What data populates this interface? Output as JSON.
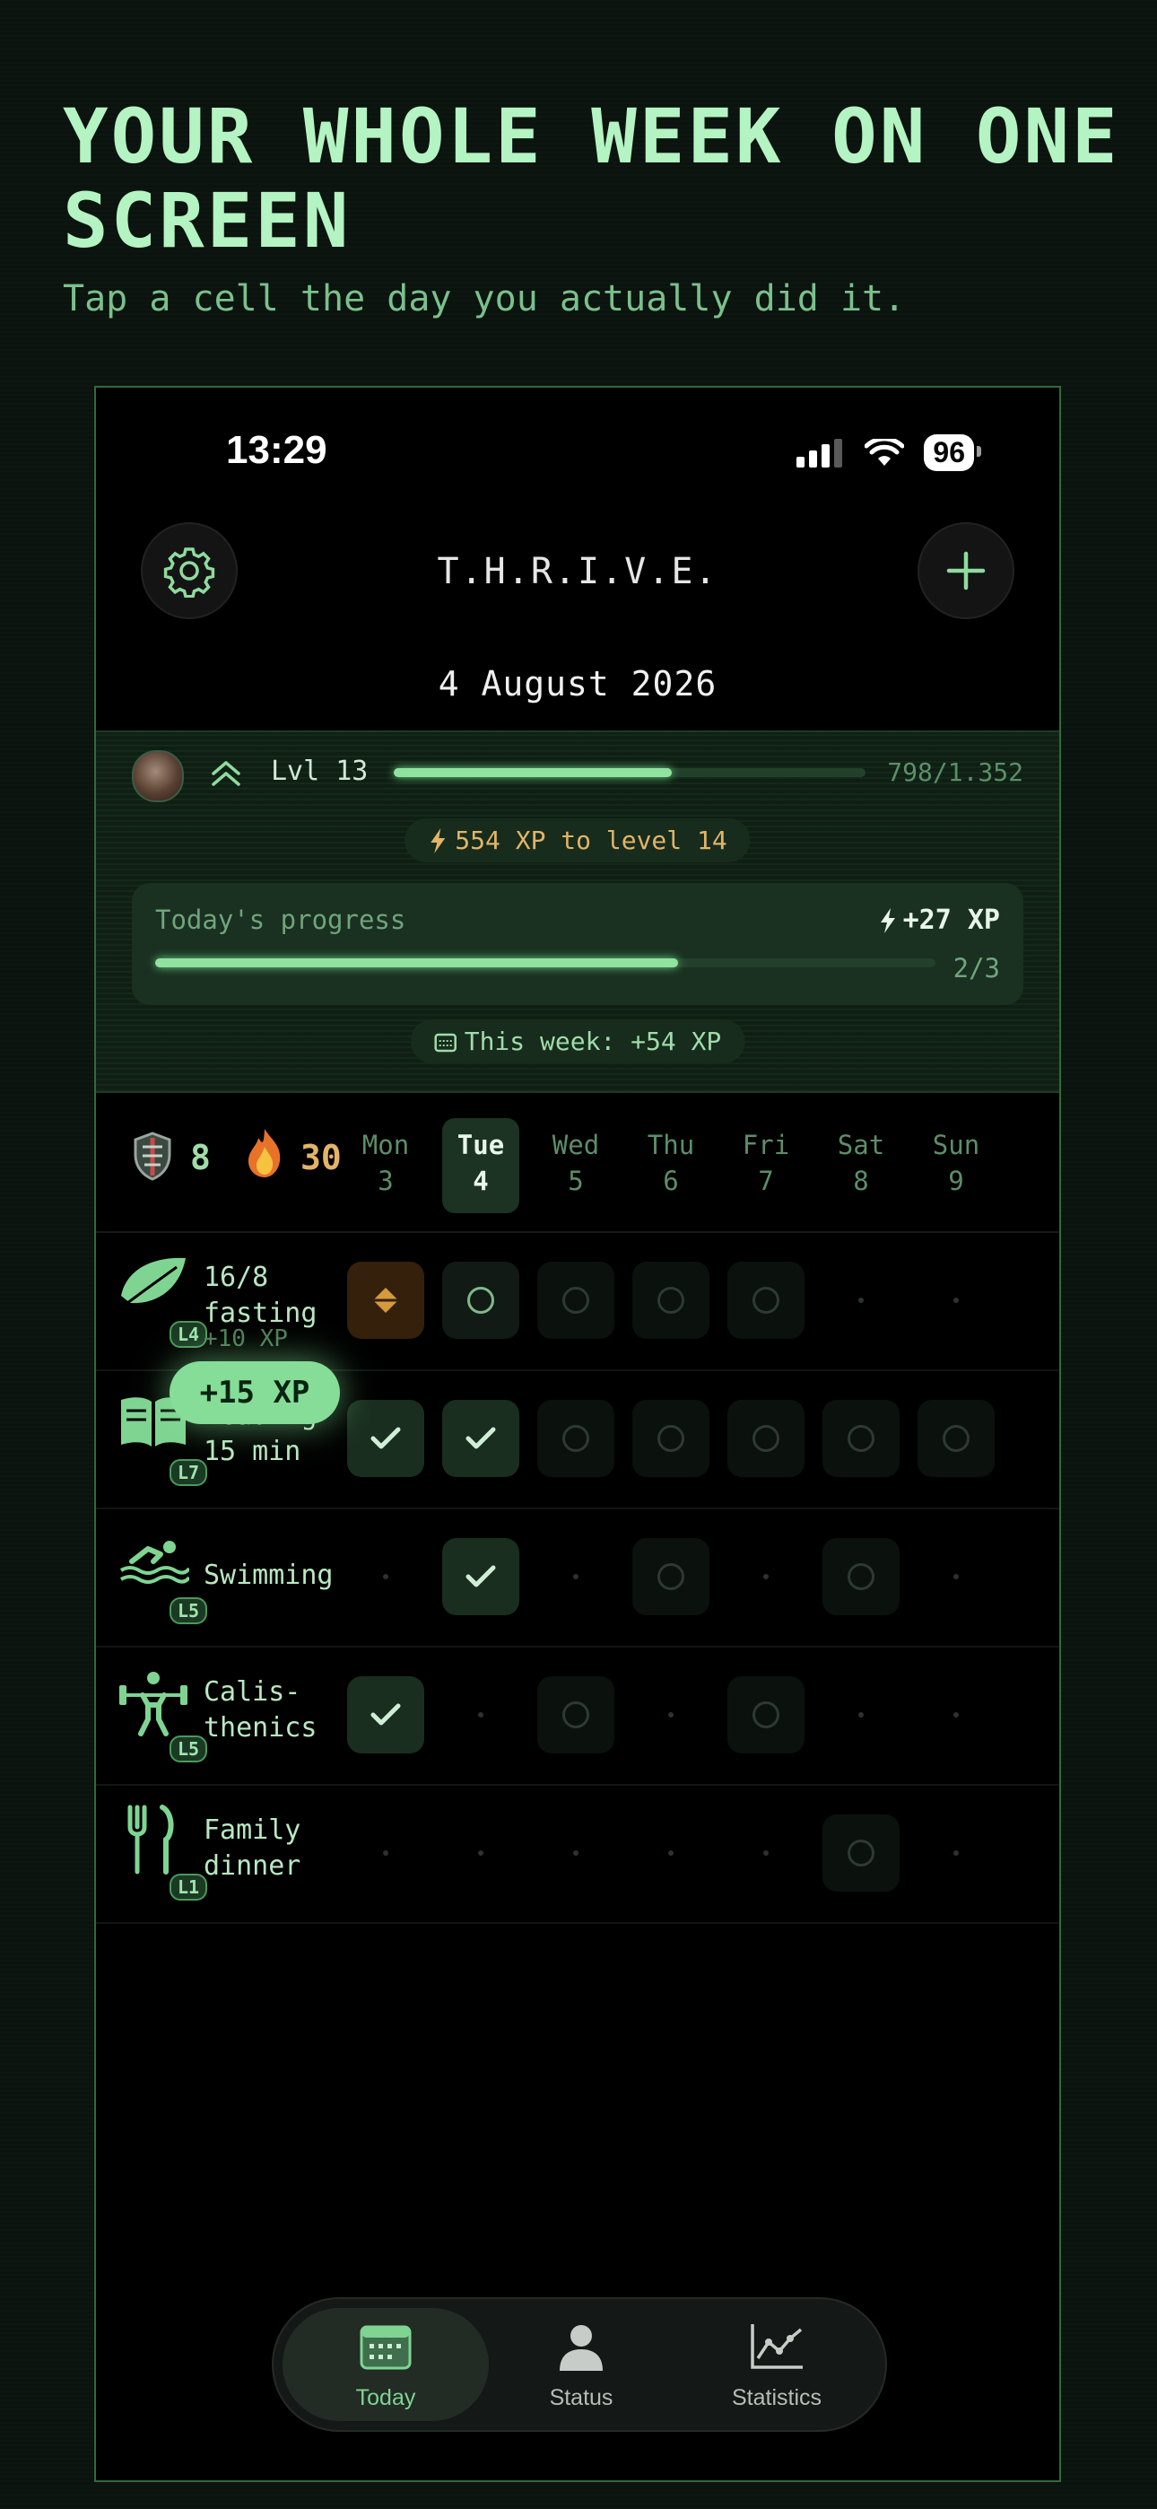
{
  "promo": {
    "headline": "YOUR WHOLE WEEK ON ONE SCREEN",
    "subhead": "Tap a cell the day you actually did it."
  },
  "status_bar": {
    "time": "13:29",
    "battery": "96"
  },
  "header": {
    "app_title": "T.H.R.I.V.E.",
    "date": "4 August 2026",
    "settings_icon": "gear-icon",
    "add_icon": "plus-icon"
  },
  "xp": {
    "level_label": "Lvl 13",
    "xp_count": "798/1.352",
    "level_progress": 0.59,
    "to_next": "554 XP to level 14",
    "today_label": "Today's progress",
    "today_xp": "+27 XP",
    "today_ratio": "2/3",
    "today_progress": 0.67,
    "week_label": "This week: +54 XP"
  },
  "streaks": {
    "shield": "8",
    "fire": "30"
  },
  "days": [
    {
      "name": "Mon",
      "num": "3"
    },
    {
      "name": "Tue",
      "num": "4"
    },
    {
      "name": "Wed",
      "num": "5"
    },
    {
      "name": "Thu",
      "num": "6"
    },
    {
      "name": "Fri",
      "num": "7"
    },
    {
      "name": "Sat",
      "num": "8"
    },
    {
      "name": "Sun",
      "num": "9"
    }
  ],
  "habits": [
    {
      "name": "16/8\nfasting",
      "level": "L4",
      "icon": "leaf-icon",
      "cells": [
        "pending",
        "ring-bright",
        "ring",
        "ring",
        "ring",
        "dot",
        "dot"
      ]
    },
    {
      "name": "Reading\n15 min",
      "level": "L7",
      "icon": "book-icon",
      "cells": [
        "done",
        "done",
        "ring",
        "ring",
        "ring",
        "ring",
        "ring"
      ]
    },
    {
      "name": "Swimming",
      "level": "L5",
      "icon": "swimmer-icon",
      "cells": [
        "dot",
        "done",
        "dot",
        "ring",
        "dot",
        "ring",
        "dot"
      ]
    },
    {
      "name": "Calis-\nthenics",
      "level": "L5",
      "icon": "weightlifter-icon",
      "cells": [
        "done",
        "dot",
        "ring",
        "dot",
        "ring",
        "dot",
        "dot"
      ]
    },
    {
      "name": "Family\ndinner",
      "level": "L1",
      "icon": "fork-knife-icon",
      "cells": [
        "dot",
        "dot",
        "dot",
        "dot",
        "dot",
        "ring",
        "dot"
      ]
    }
  ],
  "floating": {
    "toast": "+15 XP",
    "sub_xp": "+10 XP"
  },
  "tabs": [
    {
      "label": "Today",
      "icon": "calendar-icon",
      "active": true
    },
    {
      "label": "Status",
      "icon": "person-icon",
      "active": false
    },
    {
      "label": "Statistics",
      "icon": "chart-icon",
      "active": false
    }
  ]
}
